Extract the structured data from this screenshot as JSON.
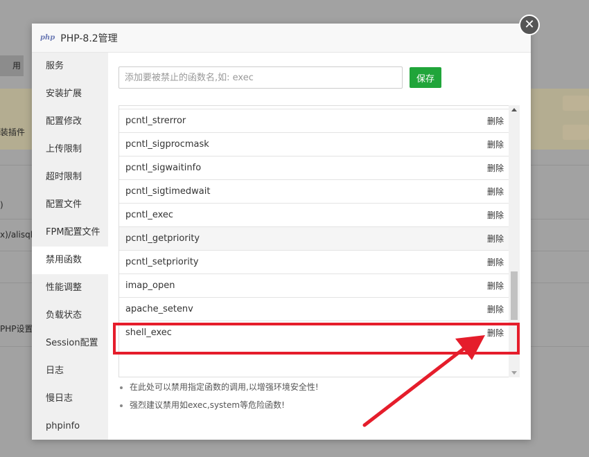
{
  "background": {
    "button_label": "用",
    "row_texts": [
      "装插件",
      ")",
      "x)/alisql/",
      "PHP设置中"
    ]
  },
  "dialog": {
    "logo": "php",
    "title": "PHP-8.2管理",
    "close_glyph": "✕"
  },
  "sidebar": {
    "items": [
      {
        "label": "服务"
      },
      {
        "label": "安装扩展"
      },
      {
        "label": "配置修改"
      },
      {
        "label": "上传限制"
      },
      {
        "label": "超时限制"
      },
      {
        "label": "配置文件"
      },
      {
        "label": "FPM配置文件"
      },
      {
        "label": "禁用函数"
      },
      {
        "label": "性能调整"
      },
      {
        "label": "负载状态"
      },
      {
        "label": "Session配置"
      },
      {
        "label": "日志"
      },
      {
        "label": "慢日志"
      },
      {
        "label": "phpinfo"
      }
    ],
    "active_index": 7
  },
  "disabled_functions": {
    "input_placeholder": "添加要被禁止的函数名,如: exec",
    "input_value": "",
    "save_label": "保存",
    "delete_label": "删除",
    "functions": [
      "pcntl_strerror",
      "pcntl_sigprocmask",
      "pcntl_sigwaitinfo",
      "pcntl_sigtimedwait",
      "pcntl_exec",
      "pcntl_getpriority",
      "pcntl_setpriority",
      "imap_open",
      "apache_setenv",
      "shell_exec"
    ],
    "highlighted_row": "pcntl_getpriority",
    "tips": [
      "在此处可以禁用指定函数的调用,以增强环境安全性!",
      "强烈建议禁用如exec,system等危险函数!"
    ]
  },
  "annotation": {
    "color": "#e51d2b",
    "target": "shell_exec"
  }
}
